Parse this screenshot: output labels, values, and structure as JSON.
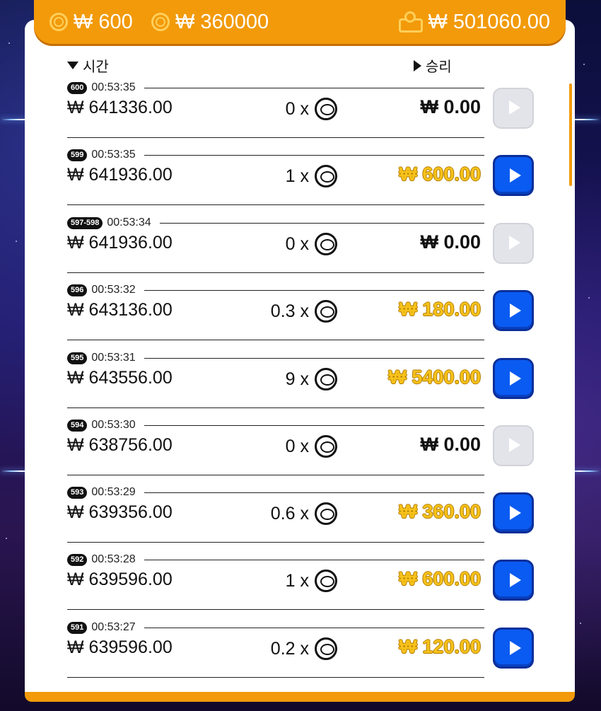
{
  "topbar": {
    "currency": "₩",
    "bet_value": "600",
    "total_value": "360000",
    "balance_value": "501060.00"
  },
  "headers": {
    "time": "시간",
    "win": "승리"
  },
  "rows": [
    {
      "id": "600",
      "time": "00:53:35",
      "amount": "₩ 641336.00",
      "multiplier": "0 x",
      "win": "₩ 0.00",
      "active": false
    },
    {
      "id": "599",
      "time": "00:53:35",
      "amount": "₩ 641936.00",
      "multiplier": "1 x",
      "win": "₩ 600.00",
      "active": true
    },
    {
      "id": "597-598",
      "time": "00:53:34",
      "amount": "₩ 641936.00",
      "multiplier": "0 x",
      "win": "₩ 0.00",
      "active": false
    },
    {
      "id": "596",
      "time": "00:53:32",
      "amount": "₩ 643136.00",
      "multiplier": "0.3 x",
      "win": "₩ 180.00",
      "active": true
    },
    {
      "id": "595",
      "time": "00:53:31",
      "amount": "₩ 643556.00",
      "multiplier": "9 x",
      "win": "₩ 5400.00",
      "active": true
    },
    {
      "id": "594",
      "time": "00:53:30",
      "amount": "₩ 638756.00",
      "multiplier": "0 x",
      "win": "₩ 0.00",
      "active": false
    },
    {
      "id": "593",
      "time": "00:53:29",
      "amount": "₩ 639356.00",
      "multiplier": "0.6 x",
      "win": "₩ 360.00",
      "active": true
    },
    {
      "id": "592",
      "time": "00:53:28",
      "amount": "₩ 639596.00",
      "multiplier": "1 x",
      "win": "₩ 600.00",
      "active": true
    },
    {
      "id": "591",
      "time": "00:53:27",
      "amount": "₩ 639596.00",
      "multiplier": "0.2 x",
      "win": "₩ 120.00",
      "active": true
    }
  ]
}
